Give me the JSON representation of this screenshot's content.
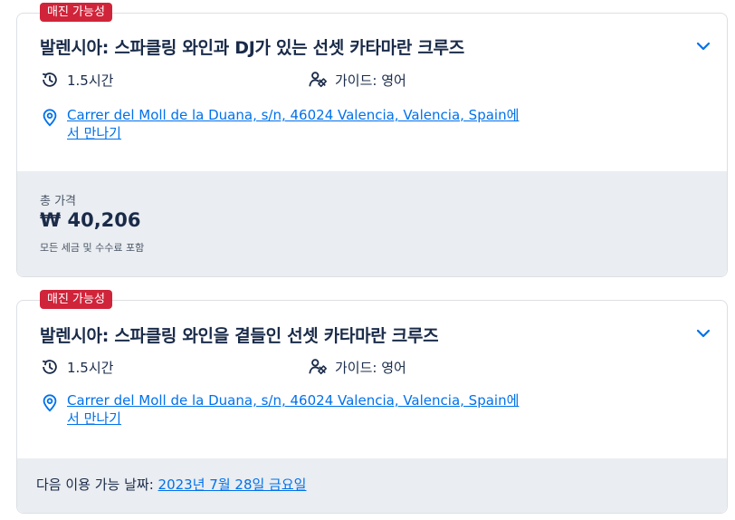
{
  "cards": [
    {
      "badge": "매진 가능성",
      "title": "발렌시아: 스파클링 와인과 DJ가 있는 선셋 카타마란 크루즈",
      "duration": "1.5시간",
      "guide": "가이드: 영어",
      "location_link": "Carrer del Moll de la Duana, s/n, 46024 Valencia, Valencia, Spain",
      "location_suffix": "에서 만나기",
      "total_label": "총 가격",
      "price": "₩ 40,206",
      "tax_note": "모든 세금 및 수수료 포함"
    },
    {
      "badge": "매진 가능성",
      "title": "발렌시아: 스파클링 와인을 곁들인 선셋 카타마란 크루즈",
      "duration": "1.5시간",
      "guide": "가이드: 영어",
      "location_link": "Carrer del Moll de la Duana, s/n, 46024 Valencia, Valencia, Spain",
      "location_suffix": "에서 만나기",
      "next_label": "다음 이용 가능 날짜:",
      "next_date": "2023년 7월 28일 금요일"
    }
  ],
  "colors": {
    "badge": "#d0243a",
    "link": "#0071eb",
    "text": "#1a2b49",
    "footer_bg": "#eaedf1"
  },
  "icons": [
    "clock-history-icon",
    "guide-people-icon",
    "location-pin-icon",
    "chevron-down-icon"
  ]
}
